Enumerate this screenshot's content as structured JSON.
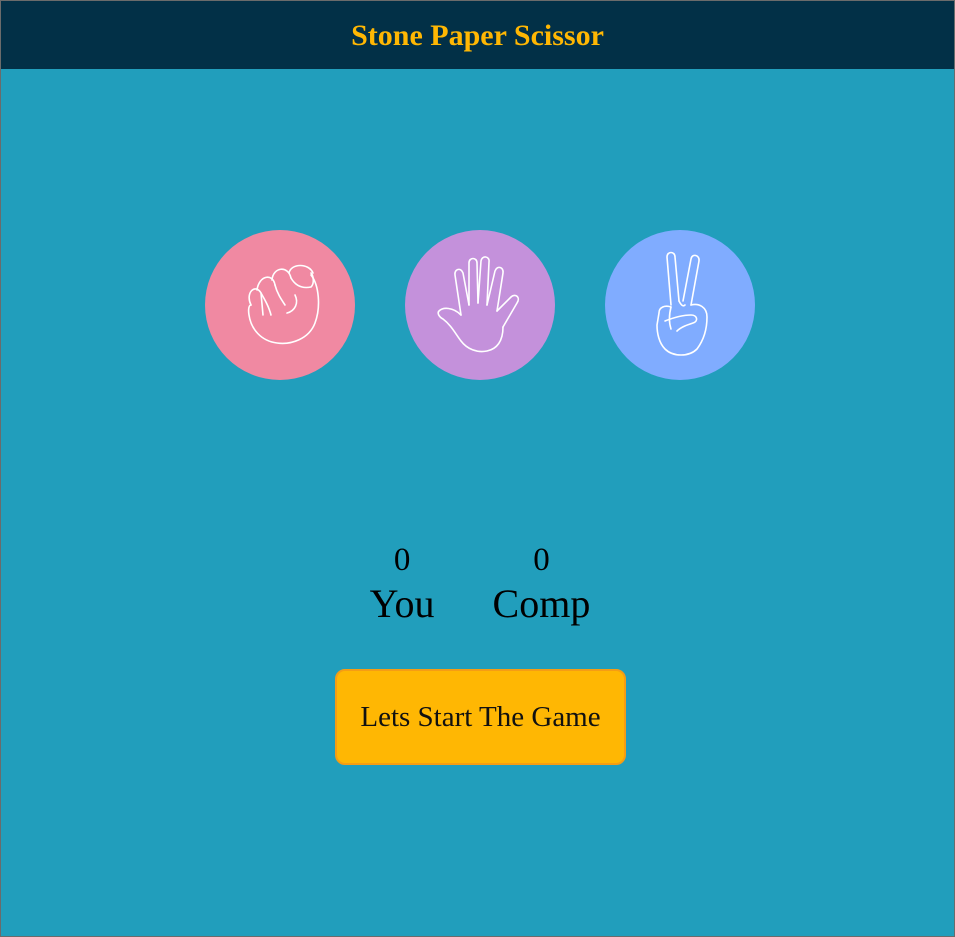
{
  "header": {
    "title": "Stone Paper Scissor"
  },
  "choices": [
    {
      "id": "stone",
      "icon": "fist-icon",
      "color": "#f089a2"
    },
    {
      "id": "paper",
      "icon": "open-hand-icon",
      "color": "#c491db"
    },
    {
      "id": "scissor",
      "icon": "peace-hand-icon",
      "color": "#80acff"
    }
  ],
  "scores": {
    "user": {
      "value": "0",
      "label": "You"
    },
    "comp": {
      "value": "0",
      "label": "Comp"
    }
  },
  "message": {
    "label": "Lets Start The Game"
  },
  "colors": {
    "background": "#219ebc",
    "header": "#023047",
    "accent": "#ffb703"
  }
}
